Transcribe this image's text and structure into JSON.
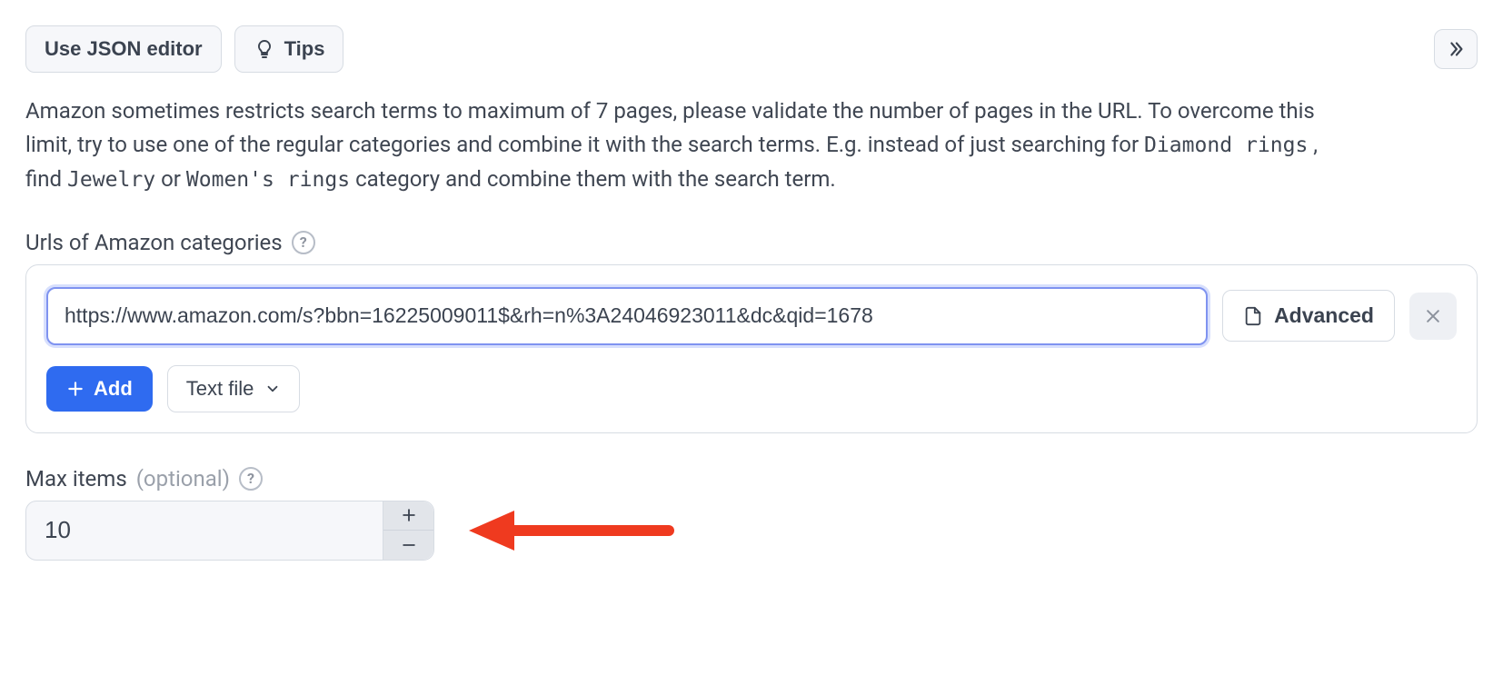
{
  "toolbar": {
    "json_editor_label": "Use JSON editor",
    "tips_label": "Tips"
  },
  "description": {
    "part1": "Amazon sometimes restricts search terms to maximum of 7 pages, please validate the number of pages in the URL. To overcome this limit, try to use one of the regular categories and combine it with the search terms. E.g. instead of just searching for ",
    "code1": "Diamond rings",
    "part2": ", find ",
    "code2": "Jewelry",
    "part3": " or ",
    "code3": "Women's rings",
    "part4": " category and combine them with the search term."
  },
  "urls_section": {
    "label": "Urls of Amazon categories",
    "input_value": "https://www.amazon.com/s?bbn=16225009011$&rh=n%3A24046923011&dc&qid=1678",
    "advanced_label": "Advanced",
    "add_label": "Add",
    "text_file_label": "Text file"
  },
  "max_items": {
    "label": "Max items",
    "optional": "(optional)",
    "value": "10"
  }
}
